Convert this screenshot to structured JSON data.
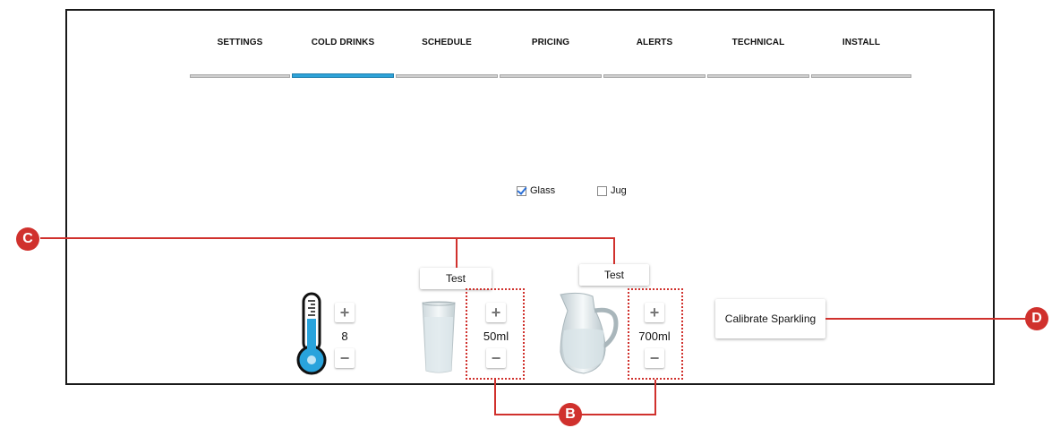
{
  "tabs": [
    {
      "label": "SETTINGS",
      "active": false
    },
    {
      "label": "COLD DRINKS",
      "active": true
    },
    {
      "label": "SCHEDULE",
      "active": false
    },
    {
      "label": "PRICING",
      "active": false
    },
    {
      "label": "ALERTS",
      "active": false
    },
    {
      "label": "TECHNICAL",
      "active": false
    },
    {
      "label": "INSTALL",
      "active": false
    }
  ],
  "options": {
    "glass": {
      "label": "Glass",
      "checked": true
    },
    "jug": {
      "label": "Jug",
      "checked": false
    }
  },
  "temperature": {
    "value": "8",
    "plus": "+",
    "minus": "−"
  },
  "glass_volume": {
    "test_label": "Test",
    "value": "50ml",
    "plus": "+",
    "minus": "−"
  },
  "jug_volume": {
    "test_label": "Test",
    "value": "700ml",
    "plus": "+",
    "minus": "−"
  },
  "calibrate": {
    "label": "Calibrate Sparkling"
  },
  "callouts": {
    "b": "B",
    "c": "C",
    "d": "D"
  },
  "colors": {
    "accent_tab": "#2ea3d8",
    "callout": "#d0312d",
    "water": "#29a3dc"
  },
  "icons": [
    "thermometer-icon",
    "glass-icon",
    "jug-icon",
    "checkbox-icon"
  ]
}
